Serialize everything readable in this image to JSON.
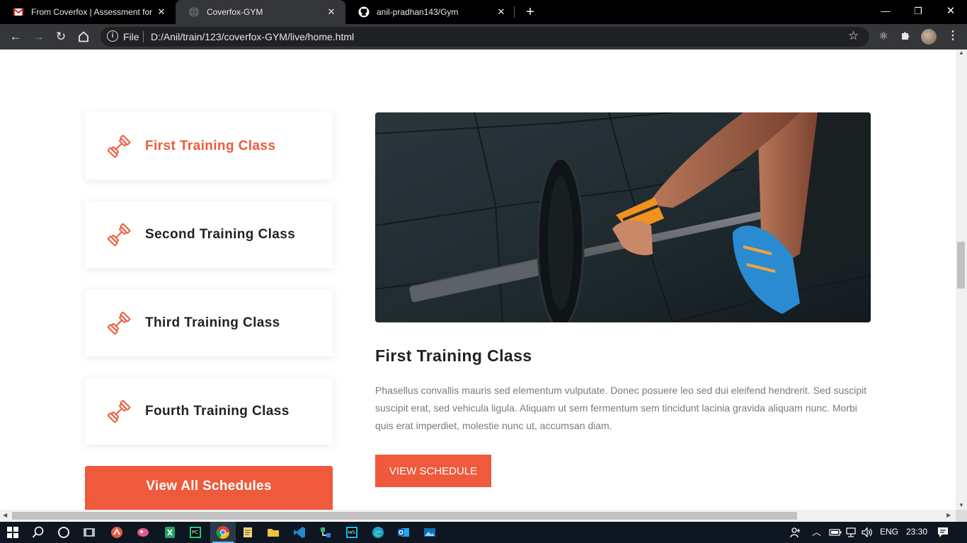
{
  "browser": {
    "tabs": [
      {
        "title": "From Coverfox | Assessment for F",
        "icon": "gmail-icon",
        "active": false
      },
      {
        "title": "Coverfox-GYM",
        "icon": "globe-icon",
        "active": true
      },
      {
        "title": "anil-pradhan143/Gym",
        "icon": "github-icon",
        "active": false
      }
    ],
    "address": {
      "scheme_label": "File",
      "url": "D:/Anil/train/123/coverfox-GYM/live/home.html"
    }
  },
  "page": {
    "classes": [
      {
        "label": "First Training Class",
        "active": true
      },
      {
        "label": "Second Training Class",
        "active": false
      },
      {
        "label": "Third Training Class",
        "active": false
      },
      {
        "label": "Fourth Training Class",
        "active": false
      }
    ],
    "view_all_label": "View All Schedules",
    "detail": {
      "title": "First Training Class",
      "description": "Phasellus convallis mauris sed elementum vulputate. Donec posuere leo sed dui eleifend hendrerit. Sed suscipit suscipit erat, sed vehicula ligula. Aliquam ut sem fermentum sem tincidunt lacinia gravida aliquam nunc. Morbi quis erat imperdiet, molestie nunc ut, accumsan diam.",
      "button_label": "VIEW SCHEDULE"
    },
    "accent_color": "#ee5a3b"
  },
  "taskbar": {
    "language": "ENG",
    "time": "23:30"
  }
}
